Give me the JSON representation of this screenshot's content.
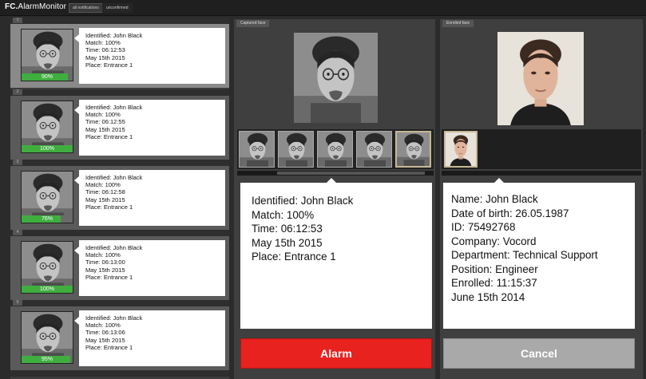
{
  "app": {
    "brand_prefix": "FC.",
    "brand_name": "AlarmMonitor",
    "tabs": [
      "all notifications",
      "unconfirmed"
    ]
  },
  "notifications": [
    {
      "header_label": "1",
      "match_percent": 90,
      "match_label": "90%",
      "lines": [
        "Identified: John Black",
        "Match: 100%",
        "Time: 06:12:53",
        "May 15th 2015",
        "Place: Entrance 1"
      ]
    },
    {
      "header_label": "2",
      "match_percent": 100,
      "match_label": "100%",
      "lines": [
        "Identified: John Black",
        "Match: 100%",
        "Time: 06:12:55",
        "May 15th 2015",
        "Place: Entrance 1"
      ]
    },
    {
      "header_label": "3",
      "match_percent": 76,
      "match_label": "76%",
      "lines": [
        "Identified: John Black",
        "Match: 100%",
        "Time: 06:12:58",
        "May 15th 2015",
        "Place: Entrance 1"
      ]
    },
    {
      "header_label": "4",
      "match_percent": 100,
      "match_label": "100%",
      "lines": [
        "Identified: John Black",
        "Match: 100%",
        "Time: 06:13:00",
        "May 15th 2015",
        "Place: Entrance 1"
      ]
    },
    {
      "header_label": "5",
      "match_percent": 95,
      "match_label": "95%",
      "lines": [
        "Identified: John Black",
        "Match: 100%",
        "Time: 06:13:06",
        "May 15th 2015",
        "Place: Entrance 1"
      ]
    }
  ],
  "captured": {
    "tab_label": "Captured face",
    "info": [
      "Identified: John Black",
      "Match: 100%",
      "Time: 06:12:53",
      "May 15th 2015",
      "Place: Entrance 1"
    ],
    "alarm_label": "Alarm"
  },
  "enrolled": {
    "tab_label": "Enrolled face",
    "info": [
      "Name: John Black",
      "Date of birth: 26.05.1987",
      "ID: 75492768",
      "Company: Vocord",
      "Department: Technical Support",
      "Position: Engineer",
      "Enrolled: 11:15:37",
      "June 15th 2014"
    ],
    "cancel_label": "Cancel"
  },
  "colors": {
    "alarm": "#e8221f",
    "match_bar": "#3fae3f",
    "cancel": "#a9a9a9"
  }
}
